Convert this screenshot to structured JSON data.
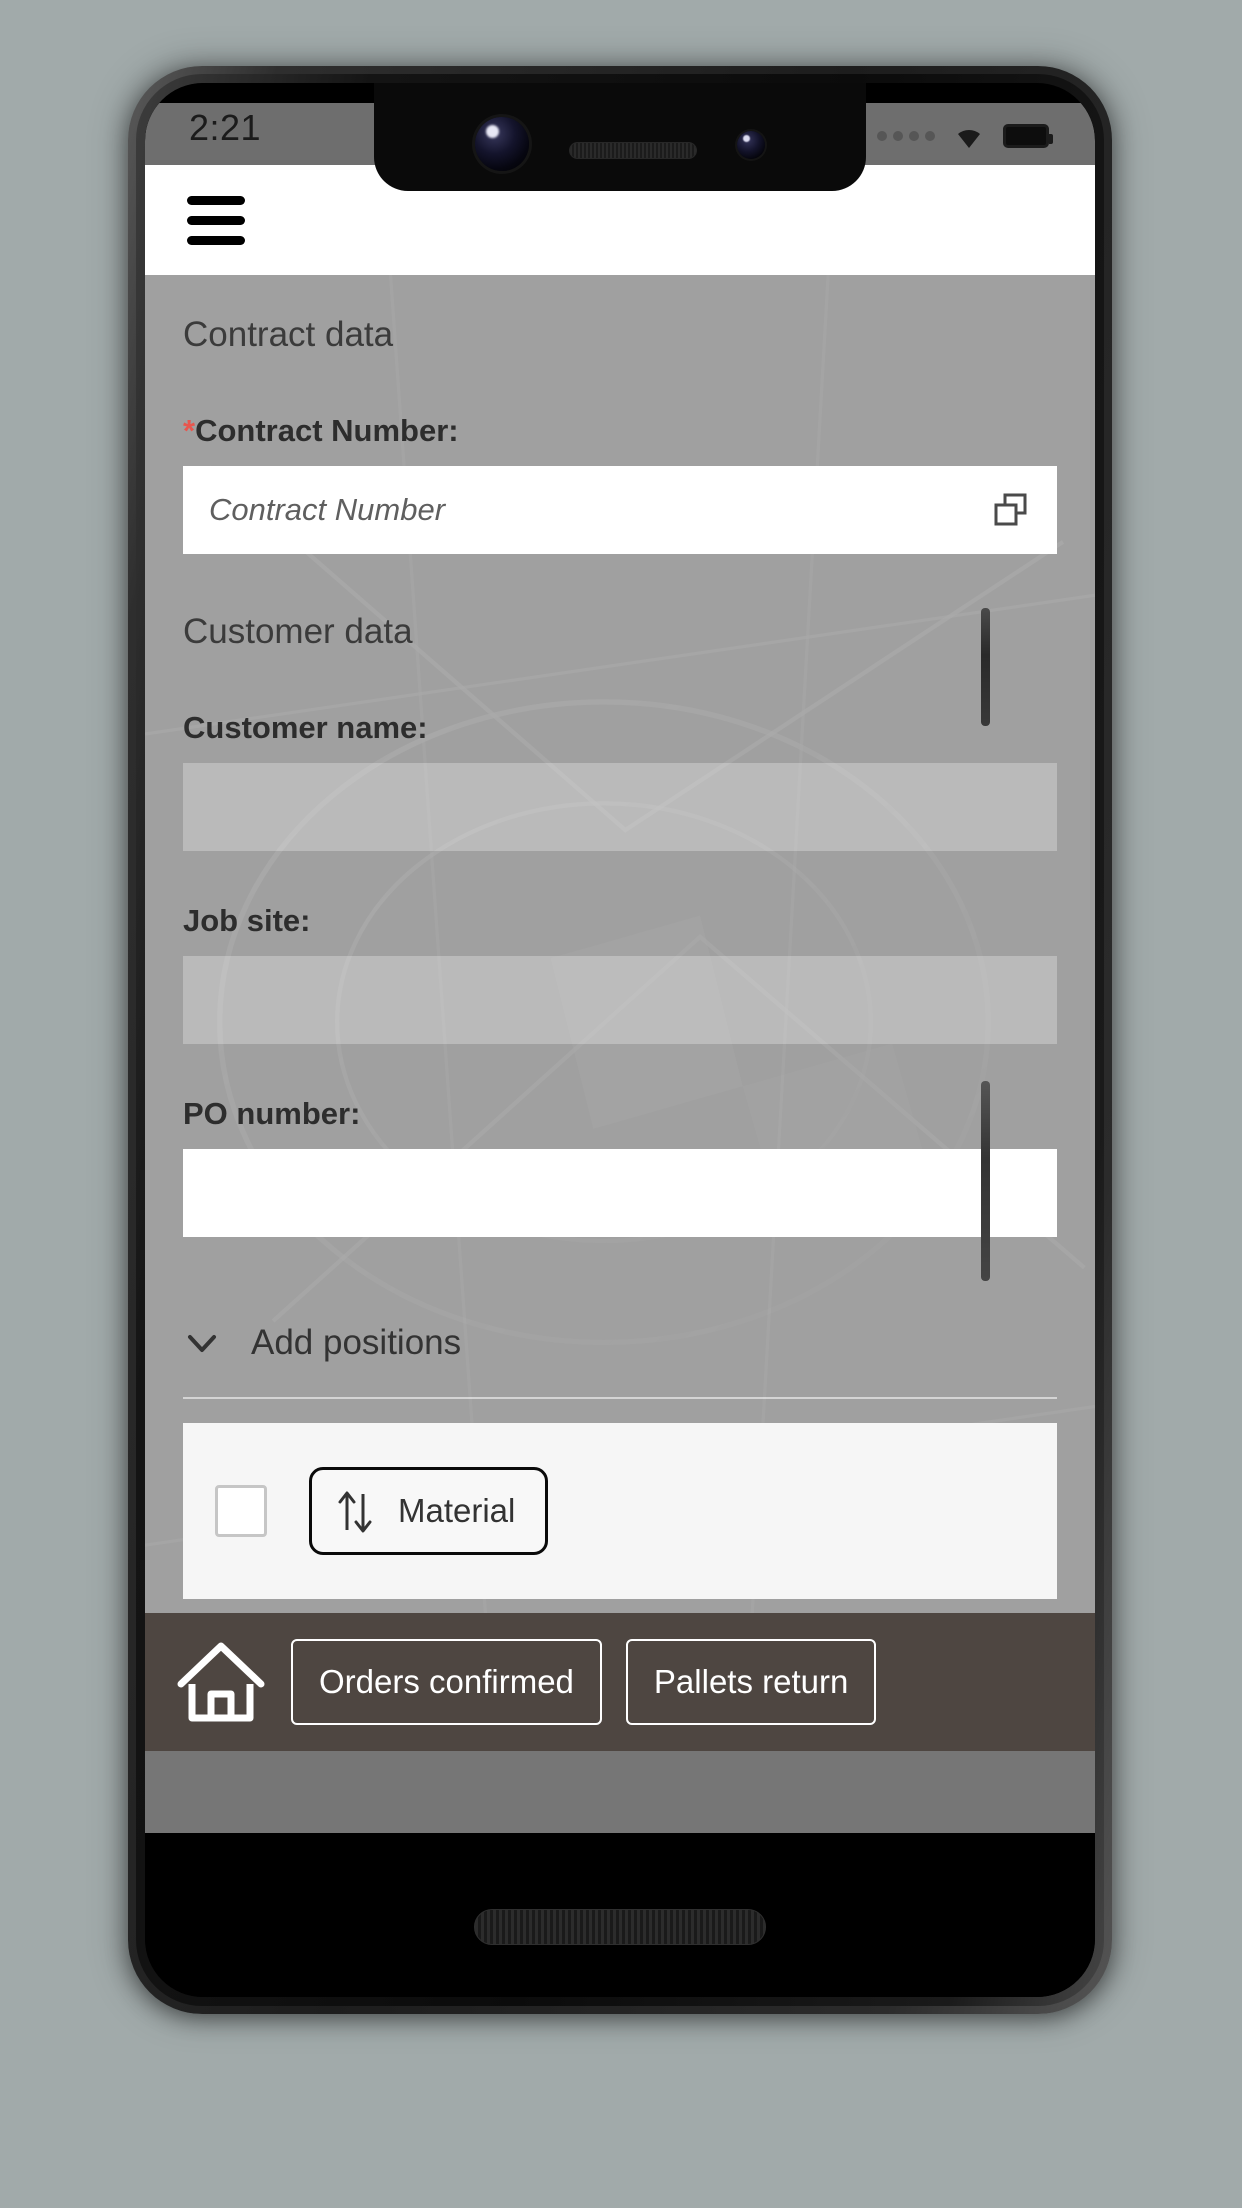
{
  "status_bar": {
    "time": "2:21",
    "signal_icon": "signal-dots-icon",
    "wifi_icon": "wifi-icon",
    "battery_icon": "battery-icon"
  },
  "app_header": {
    "menu_icon": "hamburger-menu-icon"
  },
  "content": {
    "contract_section": {
      "title": "Contract data",
      "contract_number": {
        "required_marker": "*",
        "label": "Contract Number:",
        "placeholder": "Contract Number",
        "value": "",
        "value_help_icon": "value-help-icon"
      }
    },
    "customer_section": {
      "title": "Customer data",
      "fields": [
        {
          "label": "Customer name:",
          "value": "",
          "state": "disabled"
        },
        {
          "label": "Job site:",
          "value": "",
          "state": "disabled"
        },
        {
          "label": "PO number:",
          "value": "",
          "state": "editable"
        }
      ]
    },
    "add_positions": {
      "label": "Add positions",
      "chevron_icon": "chevron-down-icon",
      "expanded": true,
      "row": {
        "checkbox_checked": false,
        "sort_button": {
          "label": "Material",
          "icon": "sort-arrows-icon"
        }
      }
    }
  },
  "toolbar": {
    "home_icon": "home-icon",
    "buttons": [
      {
        "label": "Orders confirmed"
      },
      {
        "label": "Pallets return"
      }
    ]
  },
  "colors": {
    "page_background": "#a1aaaa",
    "content_background": "#a0a0a0",
    "header_background": "#ffffff",
    "toolbar_background": "#4e4641",
    "status_bar_background": "#6e6e6e",
    "required_asterisk": "#e8564e",
    "panel_background": "#f6f6f6",
    "nav_strip": "#767676"
  }
}
